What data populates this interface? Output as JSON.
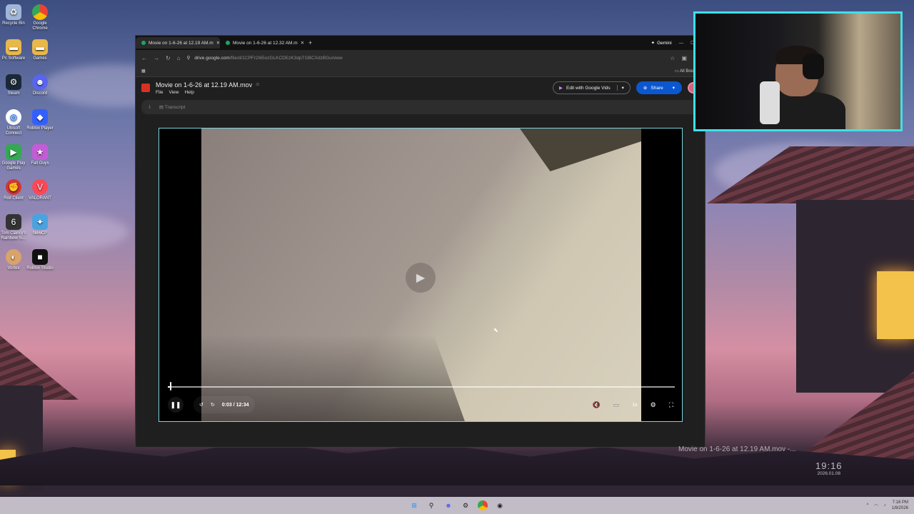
{
  "desktop": {
    "icons": [
      {
        "label": "Recycle Bin",
        "icon": "recycle-bin-icon"
      },
      {
        "label": "Google Chrome",
        "icon": "chrome-icon"
      },
      {
        "label": "Pc Software",
        "icon": "folder-icon"
      },
      {
        "label": "Games",
        "icon": "folder-icon"
      },
      {
        "label": "Steam",
        "icon": "steam-icon"
      },
      {
        "label": "Discord",
        "icon": "discord-icon"
      },
      {
        "label": "Ubisoft Connect",
        "icon": "ubisoft-icon"
      },
      {
        "label": "Roblox Player",
        "icon": "roblox-icon"
      },
      {
        "label": "Google Play Games",
        "icon": "play-games-icon"
      },
      {
        "label": "Fall Guys",
        "icon": "fall-guys-icon"
      },
      {
        "label": "Riot Client",
        "icon": "riot-icon"
      },
      {
        "label": "VALORANT",
        "icon": "valorant-icon"
      },
      {
        "label": "Tom Clancy's Rainbow Si...",
        "icon": "rainbow-six-icon"
      },
      {
        "label": "NewCP",
        "icon": "newcp-icon"
      },
      {
        "label": "Vortex",
        "icon": "vortex-icon"
      },
      {
        "label": "Roblox Studio",
        "icon": "roblox-studio-icon"
      }
    ],
    "now_playing": "Movie on 1-6-26 at 12.19 AM.mov -...",
    "clock_time": "19:16",
    "clock_date": "2026.01.08"
  },
  "browser": {
    "tabs": [
      {
        "title": "Movie on 1-6-26 at 12.19 AM.m",
        "active": true
      },
      {
        "title": "Movie on 1-6-26 at 12.32 AM.m",
        "active": false
      }
    ],
    "new_tab": "+",
    "gemini_label": "Gemini",
    "url_host": "drive.google.com",
    "url_path": "/file/d/1CPFr2I65ozGLKCDEzK3dpTGBCXdzBGu/view",
    "bookmarks_label": "All Bookm"
  },
  "drive": {
    "file_title": "Movie on 1-6-26 at 12.19 AM.mov",
    "menus": [
      "File",
      "View",
      "Help"
    ],
    "edit_vids_label": "Edit with Google Vids",
    "share_label": "Share",
    "transcript_label": "Transcript"
  },
  "player": {
    "current_time": "0:03",
    "duration": "12:34",
    "time_display": "0:03 / 12:34",
    "speed_label": "1x",
    "progress": 0.004
  },
  "taskbar": {
    "tray_time": "7:16 PM",
    "tray_date": "1/8/2026"
  },
  "colors": {
    "player_border": "#7dd3e0",
    "webcam_border": "#3fe0e8",
    "share_button": "#0b57d0"
  }
}
